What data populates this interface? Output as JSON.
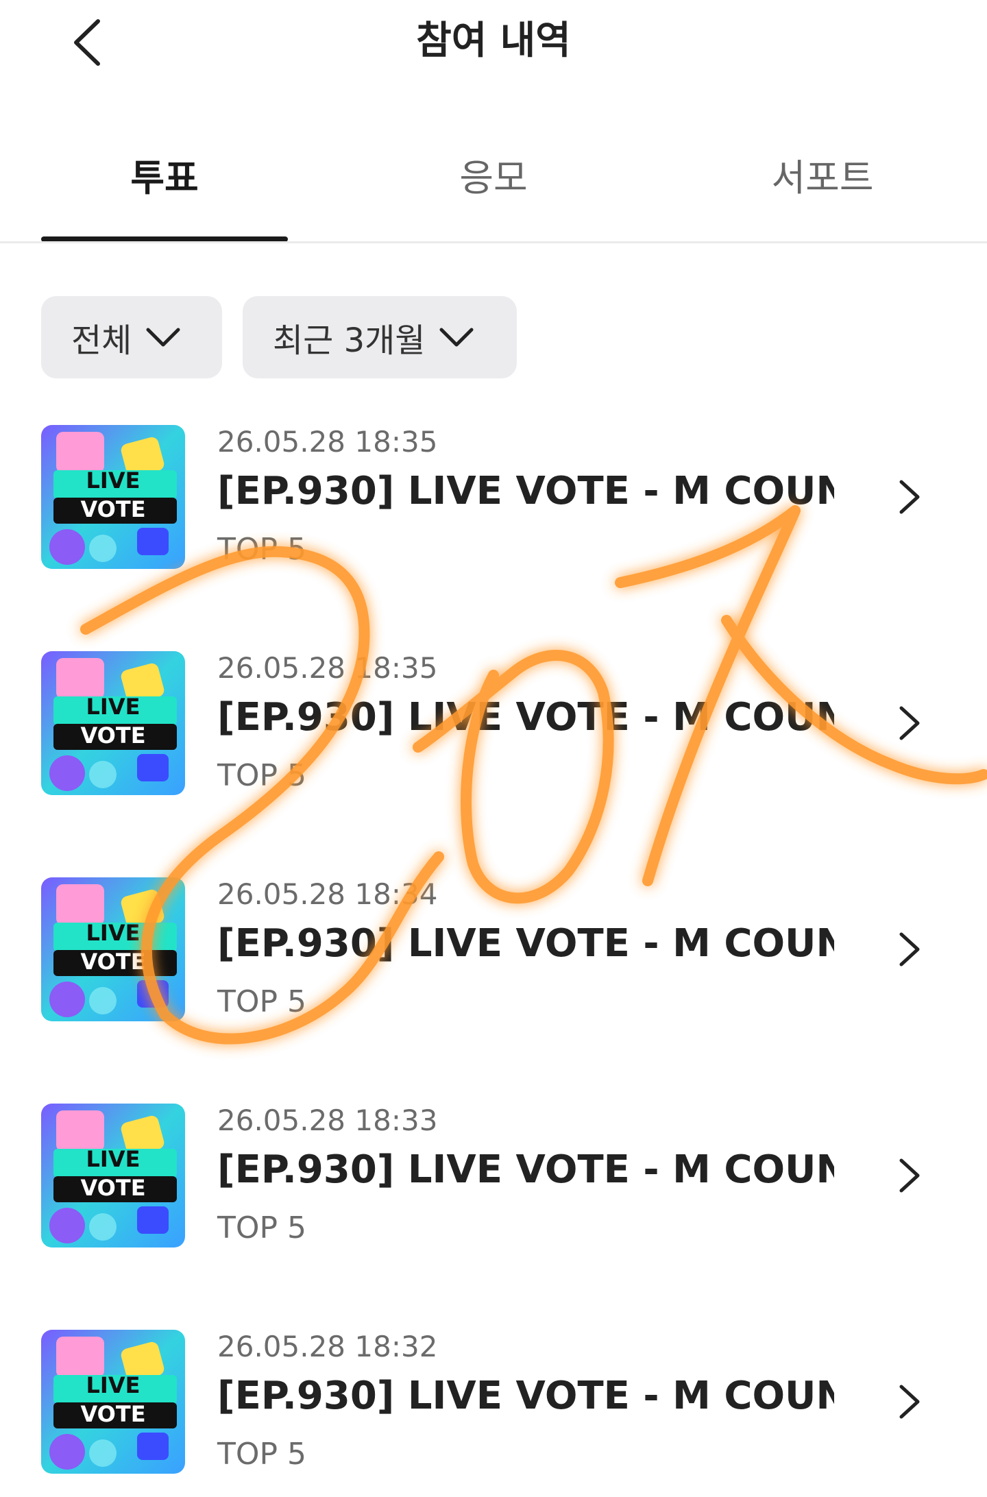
{
  "header": {
    "back_icon": "chevron-left-icon",
    "title": "참여 내역"
  },
  "tabs": [
    {
      "label": "투표",
      "active": true
    },
    {
      "label": "응모",
      "active": false
    },
    {
      "label": "서포트",
      "active": false
    }
  ],
  "filters": [
    {
      "label": "전체",
      "icon": "chevron-down-icon"
    },
    {
      "label": "최근 3개월",
      "icon": "chevron-down-icon"
    }
  ],
  "items": [
    {
      "date": "26.05.28 18:35",
      "title": "[EP.930] LIVE VOTE - M COUN...",
      "sub": "TOP 5"
    },
    {
      "date": "26.05.28 18:35",
      "title": "[EP.930] LIVE VOTE - M COUN...",
      "sub": "TOP 5"
    },
    {
      "date": "26.05.28 18:34",
      "title": "[EP.930] LIVE VOTE - M COUN...",
      "sub": "TOP 5"
    },
    {
      "date": "26.05.28 18:33",
      "title": "[EP.930] LIVE VOTE - M COUN...",
      "sub": "TOP 5"
    },
    {
      "date": "26.05.28 18:32",
      "title": "[EP.930] LIVE VOTE - M COUN...",
      "sub": "TOP 5"
    }
  ],
  "thumbnail": {
    "line1": "LIVE",
    "line2": "VOTE"
  },
  "colors": {
    "accent": "#1a1a1a",
    "chip_bg": "#ececef",
    "scribble": "#ff9a2e"
  }
}
